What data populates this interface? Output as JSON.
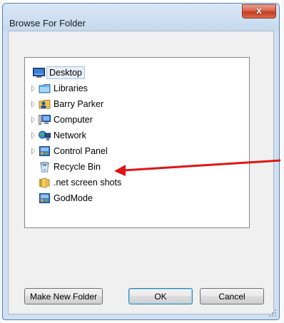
{
  "window": {
    "title": "Browse For Folder",
    "close_glyph": "x"
  },
  "tree": {
    "items": [
      {
        "label": "Desktop",
        "icon": "desktop-icon",
        "expander": false,
        "selected": true
      },
      {
        "label": "Libraries",
        "icon": "libraries-icon",
        "expander": true
      },
      {
        "label": "Barry Parker",
        "icon": "user-folder-icon",
        "expander": true
      },
      {
        "label": "Computer",
        "icon": "computer-icon",
        "expander": true
      },
      {
        "label": "Network",
        "icon": "network-icon",
        "expander": true
      },
      {
        "label": "Control Panel",
        "icon": "control-panel-icon",
        "expander": true
      },
      {
        "label": "Recycle Bin",
        "icon": "recycle-bin-icon",
        "expander": false
      },
      {
        "label": ".net screen shots",
        "icon": "folder-icon",
        "expander": false
      },
      {
        "label": "GodMode",
        "icon": "control-panel-icon",
        "expander": false
      }
    ]
  },
  "buttons": {
    "make_new_folder": "Make New Folder",
    "ok": "OK",
    "cancel": "Cancel"
  },
  "colors": {
    "annotation_arrow": "#e01515",
    "selection_bg": "#e8eff7"
  }
}
